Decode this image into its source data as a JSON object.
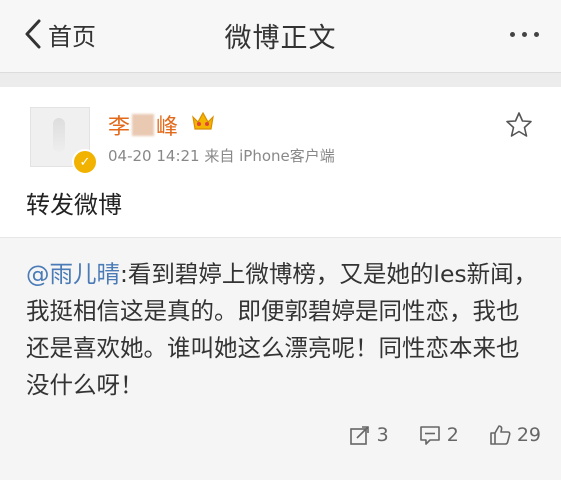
{
  "nav": {
    "back_label": "首页",
    "title": "微博正文"
  },
  "post": {
    "author_first": "李",
    "author_last": "峰",
    "time": "04-20 14:21",
    "source": "来自 iPhone客户端",
    "text": "转发微博",
    "repost": {
      "author": "@雨儿晴",
      "text": ":看到碧婷上微博榜，又是她的les新闻，我挺相信这是真的。即便郭碧婷是同性恋，我也还是喜欢她。谁叫她这么漂亮呢！同性恋本来也没什么呀！"
    }
  },
  "actions": {
    "repost_count": "3",
    "comment_count": "2",
    "like_count": "29"
  },
  "colors": {
    "username": "#e36a1b",
    "link": "#4a7bb7",
    "badge": "#f1b300"
  }
}
